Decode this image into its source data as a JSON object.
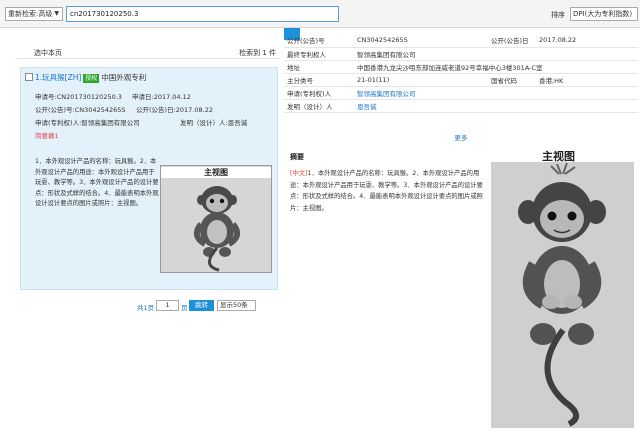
{
  "toolbar": {
    "search_mode": "重新检索:高级",
    "search_query": "cn201730120250.3",
    "sort_label": "排序",
    "sort_value": "DPI(大为专利指数)"
  },
  "list": {
    "select_page_label": "选中本页",
    "total_label": "检索到 1 件"
  },
  "result": {
    "index_title": "1.玩具猴[ZH]",
    "badge": "授权",
    "type": "中国外观专利",
    "app_no": "申请号:CN201730120250.3",
    "app_date": "申请日:2017.04.12",
    "pub_no": "公开(公告)号:CN304254265S",
    "pub_date": "公开(公告)日:2017.08.22",
    "applicant": "申请(专利权)人:智领高集团有限公司",
    "inventor": "发明（设计）人:恩吾诚",
    "flag": "简要摘1",
    "abstract": "1．本外观设计产品的名称：玩具猴。2．本外观设计产品的用途：本外观设计产品用于玩耍、教学等。3．本外观设计产品的设计要点：形状及式样的结合。4．最能表明本外观设计设计要点的图片或照片：主视图。",
    "thumb_caption": "主视图"
  },
  "pager": {
    "prefix": "共1页",
    "page_input": "1",
    "page_suffix": "页",
    "jump_label": "跳转",
    "page_size": "显示50条"
  },
  "detail": {
    "rows": [
      {
        "label": "公开(公告)号",
        "value": "CN304254265S",
        "label2": "公开(公告)日",
        "value2": "2017.08.22"
      },
      {
        "label": "最终专利权人",
        "value": "智领高集团有限公司"
      },
      {
        "label": "地址",
        "value": "中国香港九龙尖沙咀东部加连威老道92号幸福中心3楼301A-C室"
      },
      {
        "label": "主分类号",
        "value": "21-01(11)",
        "label2": "国省代码",
        "value2": "香港;HK"
      },
      {
        "label": "申请(专利权)人",
        "value": "智领高集团有限公司"
      },
      {
        "label": "发明（设计）人",
        "value": "恩吾诚"
      }
    ],
    "more_label": "更多"
  },
  "abstract_section": {
    "title": "摘要",
    "tag": "[中文]",
    "text": "1．本外观设计产品的名称：玩具猴。2．本外观设计产品的用途：本外观设计产品用于玩耍、教学等。3．本外观设计产品的设计要点：形状及式样的结合。4．最能表明本外观设计设计要点的图片或照片：主视图。"
  },
  "figure": {
    "caption": "主视图"
  }
}
